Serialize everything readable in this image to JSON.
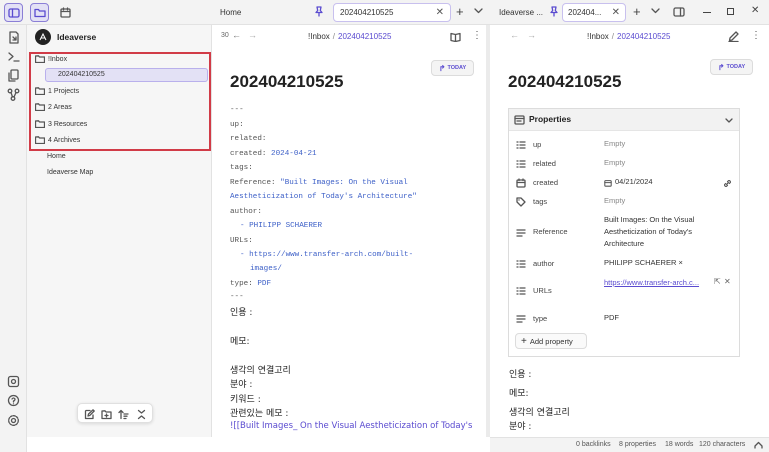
{
  "tabs": [
    {
      "label": "Home"
    },
    {
      "label": "202404210525"
    },
    {
      "label": "Ideaverse ..."
    },
    {
      "label": "202404..."
    }
  ],
  "sidebar": {
    "vault_name": "Ideaverse",
    "tree": [
      {
        "label": "!Inbox"
      },
      {
        "label": "202404210525"
      },
      {
        "label": "1 Projects"
      },
      {
        "label": "2 Areas"
      },
      {
        "label": "3 Resources"
      },
      {
        "label": "4 Archives"
      },
      {
        "label": "Home"
      },
      {
        "label": "Ideaverse Map"
      }
    ]
  },
  "left_pane": {
    "back_count": "30",
    "crumb_parent": "!Inbox",
    "crumb_sep": "/",
    "crumb_current": "202404210525",
    "today_label": "TODAY",
    "title": "202404210525",
    "frontmatter": {
      "sep": "---",
      "up": "up:",
      "related": "related:",
      "created_key": "created:",
      "created_val": "2024-04-21",
      "tags": "tags:",
      "ref_key": "Reference:",
      "ref_val_1": "\"Built Images: On the Visual",
      "ref_val_2": "Aestheticization of Today's Architecture\"",
      "author_key": "author:",
      "author_val": "- PHILIPP SCHAERER",
      "urls_key": "URLs:",
      "url_1": "- https://www.transfer-arch.com/built-",
      "url_2": "images/",
      "type_key": "type:",
      "type_val": "PDF",
      "sep_end": "---"
    },
    "body": {
      "quote": "인용 :",
      "memo": "메모:",
      "thought": "생각의 연결고리",
      "field": "분야 :",
      "keyword": "키워드 :",
      "related_memo": "관련있는 메모 :",
      "link": "![[Built Images_ On the Visual Aestheticization of Today's"
    }
  },
  "right_pane": {
    "crumb_parent": "!Inbox",
    "crumb_sep": "/",
    "crumb_current": "202404210525",
    "today_label": "TODAY",
    "title": "202404210525",
    "properties_heading": "Properties",
    "properties": {
      "up": {
        "name": "up",
        "value": "Empty"
      },
      "related": {
        "name": "related",
        "value": "Empty"
      },
      "created": {
        "name": "created",
        "value": "04/21/2024"
      },
      "tags": {
        "name": "tags",
        "value": "Empty"
      },
      "reference": {
        "name": "Reference",
        "value": "Built Images: On the Visual Aestheticization of Today's Architecture"
      },
      "author": {
        "name": "author",
        "value": "PHILIPP SCHAERER ×"
      },
      "urls": {
        "name": "URLs",
        "value": "https://www.transfer-arch.c..."
      },
      "type": {
        "name": "type",
        "value": "PDF"
      }
    },
    "add_property": "Add property",
    "body": {
      "quote": "인용 :",
      "memo": "메모:",
      "thought": "생각의 연결고리",
      "field": "분야 :"
    }
  },
  "status_bar": {
    "backlinks": "0 backlinks",
    "properties": "8 properties",
    "words": "18 words",
    "characters": "120 characters"
  },
  "colors": {
    "accent": "#5a4bd0",
    "highlight_border": "#d13b47",
    "link_blue": "#3c5fc7"
  }
}
